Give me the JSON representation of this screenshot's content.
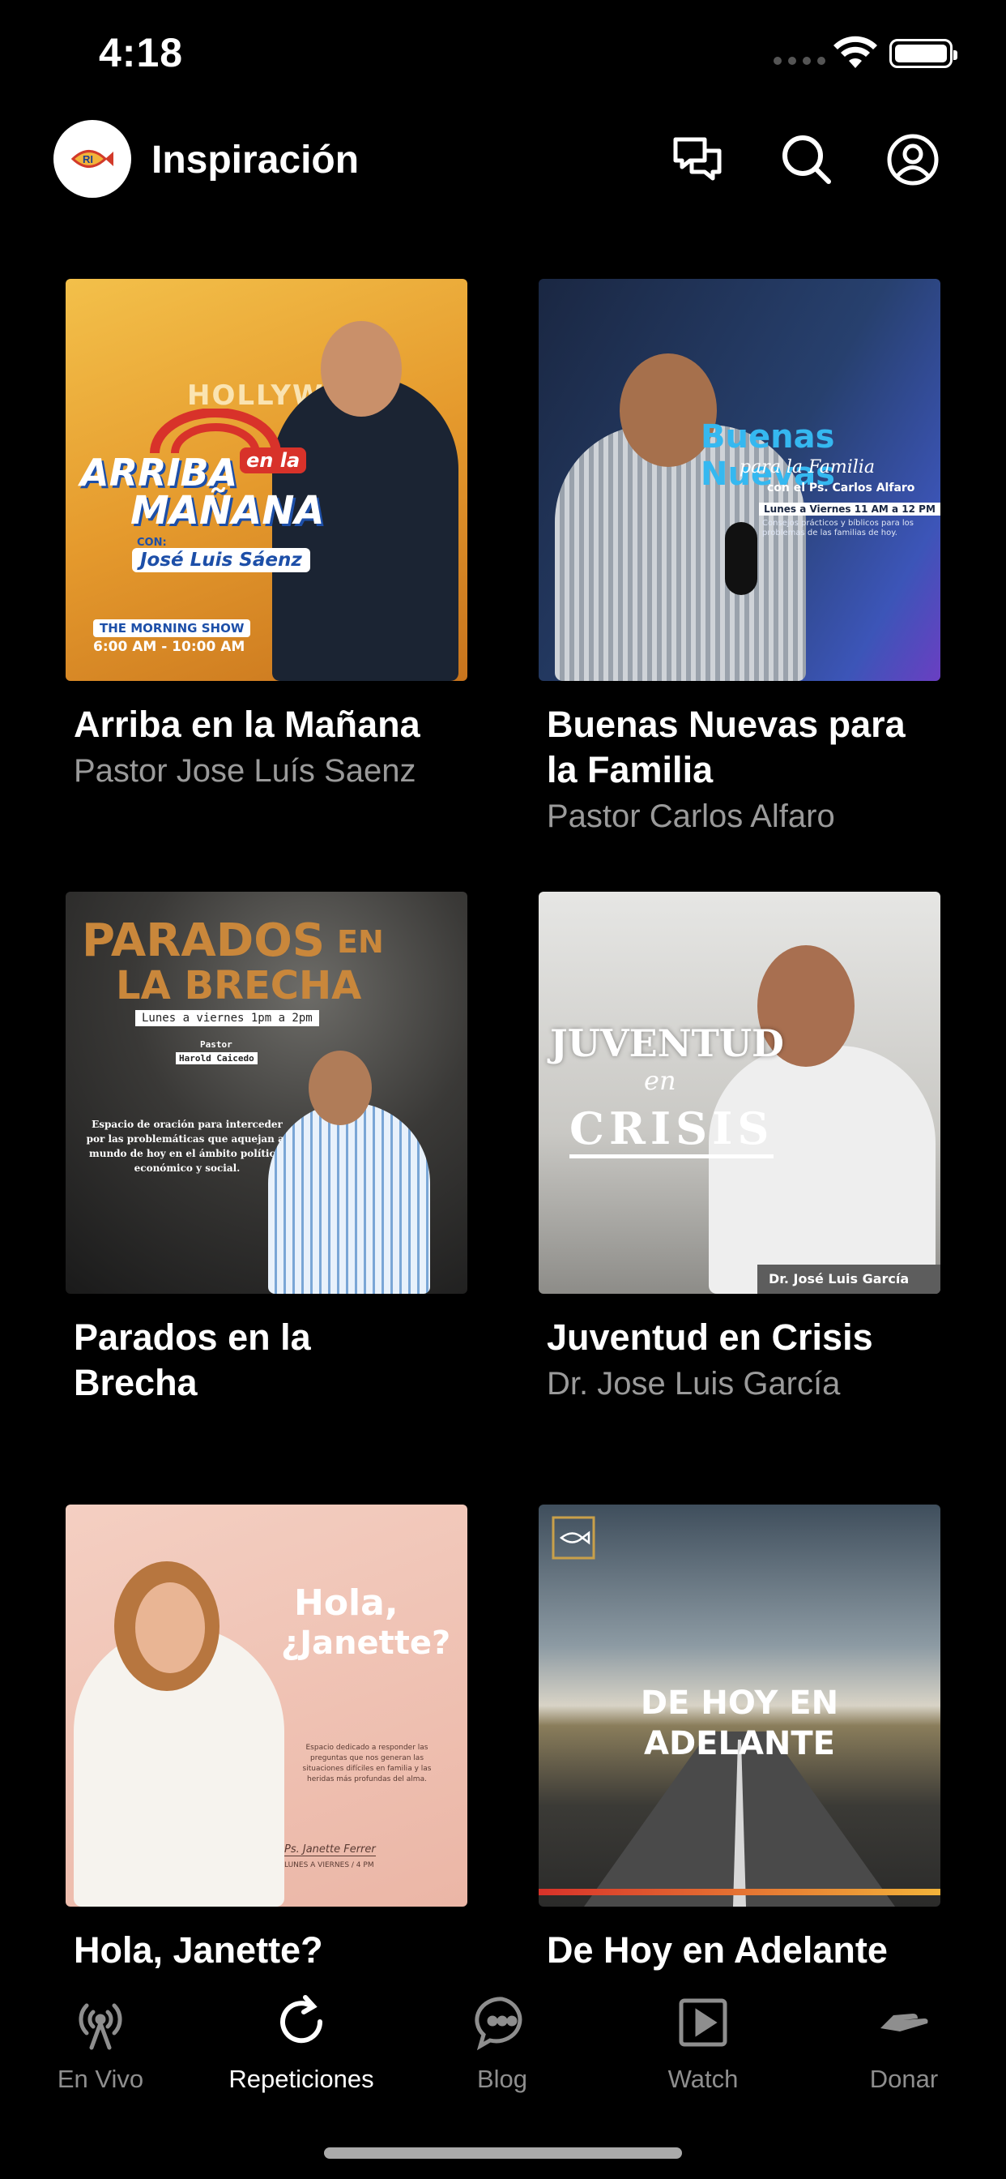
{
  "status": {
    "time": "4:18"
  },
  "header": {
    "title": "Inspiración",
    "logo_text": "RI"
  },
  "shows": [
    {
      "title": "Arriba en la Mañana",
      "host": "Pastor Jose Luís Saenz",
      "art": {
        "line1": "ARRIBA",
        "badge": "en la",
        "line2": "MAÑANA",
        "con": "CON:",
        "name": "José Luis Sáenz",
        "show": "THE MORNING SHOW",
        "hours": "6:00 AM - 10:00 AM",
        "sign": "HOLLYWOOD"
      }
    },
    {
      "title": "Buenas Nuevas para la Familia",
      "host": "Pastor Carlos Alfaro",
      "art": {
        "line1": "Buenas Nuevas",
        "line2": "para la Familia",
        "with": "con el Ps. Carlos Alfaro",
        "days": "Lunes a Viernes 11 AM a 12 PM",
        "desc": "Consejos prácticos y bíblicos para los problemas de las familias de hoy."
      }
    },
    {
      "title": "Parados en la Brecha",
      "host": "",
      "art": {
        "line1a": "PARADOS",
        "line1b": "EN",
        "line2": "LA BRECHA",
        "days": "Lunes a viernes 1pm a 2pm",
        "pastor": "Pastor",
        "name": "Harold Caicedo",
        "desc": "Espacio de oración para interceder por las problemáticas que aquejan al mundo de hoy en el ámbito político, económico y social."
      }
    },
    {
      "title": "Juventud en Crisis",
      "host": "Dr. Jose Luis García",
      "art": {
        "line1": "JUVENTUD",
        "line2": "en",
        "line3": "CRISIS",
        "name": "Dr. José Luis García"
      }
    },
    {
      "title": "Hola, Janette?",
      "host": "",
      "art": {
        "line1": "Hola,",
        "line2": "¿Janette?",
        "desc": "Espacio dedicado a responder las preguntas que nos generan las situaciones difíciles en familia y las heridas más profundas del alma.",
        "name": "Ps. Janette Ferrer",
        "days": "LUNES A VIERNES / 4 PM"
      }
    },
    {
      "title": "De Hoy en Adelante",
      "host": "",
      "art": {
        "line1": "DE HOY EN",
        "line2": "ADELANTE"
      }
    }
  ],
  "tabs": [
    {
      "label": "En Vivo",
      "icon": "antenna-icon",
      "active": false
    },
    {
      "label": "Repeticiones",
      "icon": "replay-icon",
      "active": true
    },
    {
      "label": "Blog",
      "icon": "chat-bubble-icon",
      "active": false
    },
    {
      "label": "Watch",
      "icon": "play-icon",
      "active": false
    },
    {
      "label": "Donar",
      "icon": "donate-hand-icon",
      "active": false
    }
  ],
  "colors": {
    "background": "#000000",
    "text": "#ffffff",
    "secondary_text": "#9a9a9a",
    "inactive_tab": "#8e8e8e"
  }
}
